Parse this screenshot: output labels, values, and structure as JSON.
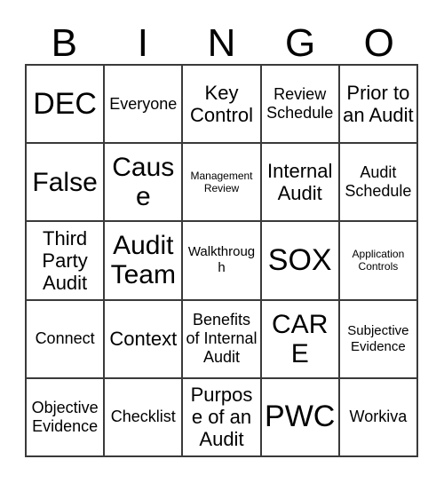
{
  "card": {
    "title": "Bingo Card",
    "header_letters": [
      "B",
      "I",
      "N",
      "G",
      "O"
    ],
    "grid_size": "5x5",
    "colors": {
      "text": "#000000",
      "grid_line": "#3a3a3a",
      "background": "#ffffff"
    },
    "rows": [
      [
        {
          "text": "DEC",
          "size": "xxl"
        },
        {
          "text": "Everyone",
          "size": "m"
        },
        {
          "text": "Key Control",
          "size": "l"
        },
        {
          "text": "Review Schedule",
          "size": "m"
        },
        {
          "text": "Prior to an Audit",
          "size": "l"
        }
      ],
      [
        {
          "text": "False",
          "size": "xl"
        },
        {
          "text": "Cause",
          "size": "xl"
        },
        {
          "text": "Management Review",
          "size": "xs"
        },
        {
          "text": "Internal Audit",
          "size": "l"
        },
        {
          "text": "Audit Schedule",
          "size": "m"
        }
      ],
      [
        {
          "text": "Third Party Audit",
          "size": "l"
        },
        {
          "text": "Audit Team",
          "size": "xl"
        },
        {
          "text": "Walkthrough",
          "size": "s"
        },
        {
          "text": "SOX",
          "size": "xxl"
        },
        {
          "text": "Application Controls",
          "size": "xs"
        }
      ],
      [
        {
          "text": "Connect",
          "size": "m"
        },
        {
          "text": "Context",
          "size": "l"
        },
        {
          "text": "Benefits of Internal Audit",
          "size": "m"
        },
        {
          "text": "CARE",
          "size": "xl"
        },
        {
          "text": "Subjective Evidence",
          "size": "s"
        }
      ],
      [
        {
          "text": "Objective Evidence",
          "size": "m"
        },
        {
          "text": "Checklist",
          "size": "m"
        },
        {
          "text": "Purpose of an Audit",
          "size": "l"
        },
        {
          "text": "PWC",
          "size": "xxl"
        },
        {
          "text": "Workiva",
          "size": "m"
        }
      ]
    ]
  }
}
